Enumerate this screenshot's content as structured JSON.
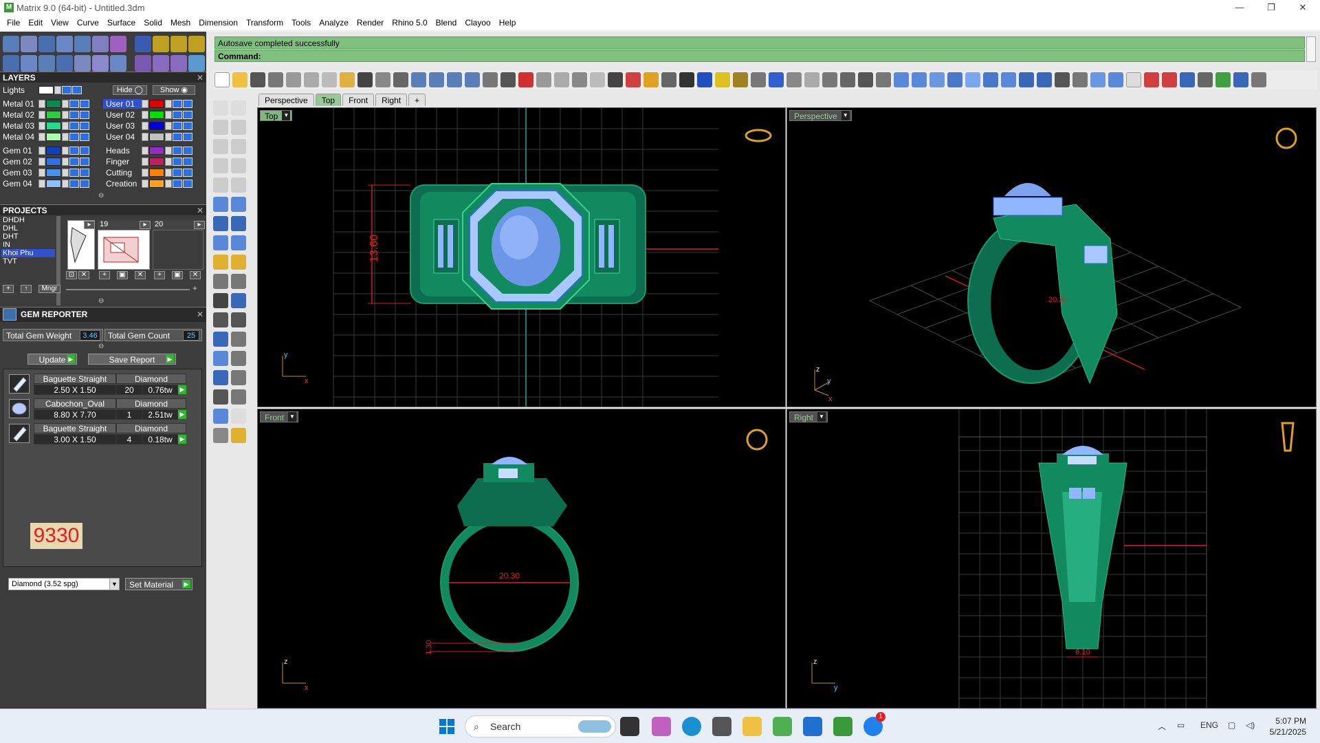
{
  "window": {
    "title": "Matrix 9.0 (64-bit) - Untitled.3dm"
  },
  "menu": [
    "File",
    "Edit",
    "View",
    "Curve",
    "Surface",
    "Solid",
    "Mesh",
    "Dimension",
    "Transform",
    "Tools",
    "Analyze",
    "Render",
    "Rhino 5.0",
    "Blend",
    "Clayoo",
    "Help"
  ],
  "layers": {
    "title": "LAYERS",
    "lights_label": "Lights",
    "hide_label": "Hide",
    "show_label": "Show",
    "left": [
      {
        "name": "Metal 01",
        "color": "#0a8a50"
      },
      {
        "name": "Metal 02",
        "color": "#2ecc40"
      },
      {
        "name": "Metal 03",
        "color": "#22dd88"
      },
      {
        "name": "Metal 04",
        "color": "#aaffaa"
      },
      {
        "name": "Gem 01",
        "color": "#1040c0"
      },
      {
        "name": "Gem 02",
        "color": "#3070e0"
      },
      {
        "name": "Gem 03",
        "color": "#4a90f0"
      },
      {
        "name": "Gem 04",
        "color": "#8ac0ff"
      }
    ],
    "right": [
      {
        "name": "User 01",
        "color": "#e00000",
        "active": true
      },
      {
        "name": "User 02",
        "color": "#00e000"
      },
      {
        "name": "User 03",
        "color": "#0000e0"
      },
      {
        "name": "User 04",
        "color": "#c0c0c0"
      },
      {
        "name": "Heads",
        "color": "#9030c0"
      },
      {
        "name": "Finger",
        "color": "#c02060"
      },
      {
        "name": "Cutting",
        "color": "#ff8000"
      },
      {
        "name": "Creation",
        "color": "#ffa020"
      }
    ]
  },
  "projects": {
    "title": "PROJECTS",
    "items": [
      "DHDH",
      "DHL",
      "DHT",
      "IN",
      "Khoi Phu",
      "TVT"
    ],
    "selected": "Khoi Phu",
    "thumb_numbers": [
      "19",
      "20"
    ],
    "mngr_label": "Mngr"
  },
  "gem_reporter": {
    "title": "GEM REPORTER",
    "weight_label": "Total Gem Weight",
    "weight_value": "3.46",
    "count_label": "Total Gem Count",
    "count_value": "25",
    "update_label": "Update",
    "save_label": "Save Report",
    "rows": [
      {
        "shape": "Baguette Straight",
        "material": "Diamond",
        "size": "2.50 X 1.50",
        "qty": "20",
        "weight": "0.76tw"
      },
      {
        "shape": "Cabochon_Oval",
        "material": "Diamond",
        "size": "8.80 X 7.70",
        "qty": "1",
        "weight": "2.51tw"
      },
      {
        "shape": "Baguette Straight",
        "material": "Diamond",
        "size": "3.00 X 1.50",
        "qty": "4",
        "weight": "0.18tw"
      }
    ],
    "big_number": "9330",
    "material_select": "Diamond    (3.52 spg)",
    "set_material_label": "Set Material"
  },
  "command": {
    "history": "Autosave completed successfully",
    "prompt": "Command:"
  },
  "viewport_tabs": [
    "Perspective",
    "Top",
    "Front",
    "Right",
    "+"
  ],
  "active_tab": "Top",
  "viewports": {
    "top": {
      "label": "Top",
      "dimension": "13.60"
    },
    "perspective": {
      "label": "Perspective",
      "dimension": "20.30"
    },
    "front": {
      "label": "Front",
      "dimension": "20.30",
      "dimension2": "1.30"
    },
    "right": {
      "label": "Right",
      "dimension": "6.10"
    }
  },
  "axes": {
    "x": "x",
    "y": "y",
    "z": "z"
  },
  "taskbar": {
    "search_placeholder": "Search",
    "language": "ENG",
    "time": "5:07 PM",
    "date": "5/21/2025",
    "notification_badge": "1"
  }
}
